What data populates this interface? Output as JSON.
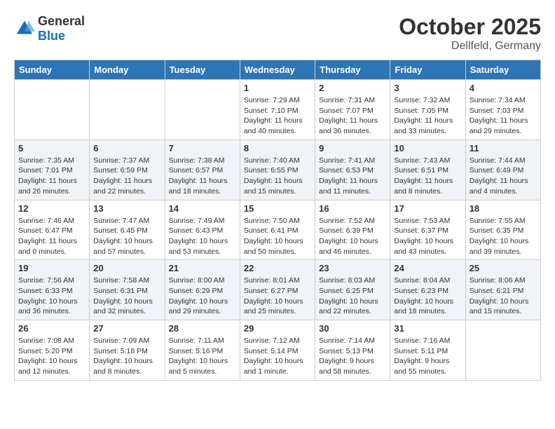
{
  "header": {
    "logo": {
      "general": "General",
      "blue": "Blue"
    },
    "title": "October 2025",
    "location": "Dellfeld, Germany"
  },
  "calendar": {
    "days_of_week": [
      "Sunday",
      "Monday",
      "Tuesday",
      "Wednesday",
      "Thursday",
      "Friday",
      "Saturday"
    ],
    "weeks": [
      [
        {
          "day": "",
          "info": ""
        },
        {
          "day": "",
          "info": ""
        },
        {
          "day": "",
          "info": ""
        },
        {
          "day": "1",
          "info": "Sunrise: 7:29 AM\nSunset: 7:10 PM\nDaylight: 11 hours and 40 minutes."
        },
        {
          "day": "2",
          "info": "Sunrise: 7:31 AM\nSunset: 7:07 PM\nDaylight: 11 hours and 36 minutes."
        },
        {
          "day": "3",
          "info": "Sunrise: 7:32 AM\nSunset: 7:05 PM\nDaylight: 11 hours and 33 minutes."
        },
        {
          "day": "4",
          "info": "Sunrise: 7:34 AM\nSunset: 7:03 PM\nDaylight: 11 hours and 29 minutes."
        }
      ],
      [
        {
          "day": "5",
          "info": "Sunrise: 7:35 AM\nSunset: 7:01 PM\nDaylight: 11 hours and 26 minutes."
        },
        {
          "day": "6",
          "info": "Sunrise: 7:37 AM\nSunset: 6:59 PM\nDaylight: 11 hours and 22 minutes."
        },
        {
          "day": "7",
          "info": "Sunrise: 7:38 AM\nSunset: 6:57 PM\nDaylight: 11 hours and 18 minutes."
        },
        {
          "day": "8",
          "info": "Sunrise: 7:40 AM\nSunset: 6:55 PM\nDaylight: 11 hours and 15 minutes."
        },
        {
          "day": "9",
          "info": "Sunrise: 7:41 AM\nSunset: 6:53 PM\nDaylight: 11 hours and 11 minutes."
        },
        {
          "day": "10",
          "info": "Sunrise: 7:43 AM\nSunset: 6:51 PM\nDaylight: 11 hours and 8 minutes."
        },
        {
          "day": "11",
          "info": "Sunrise: 7:44 AM\nSunset: 6:49 PM\nDaylight: 11 hours and 4 minutes."
        }
      ],
      [
        {
          "day": "12",
          "info": "Sunrise: 7:46 AM\nSunset: 6:47 PM\nDaylight: 11 hours and 0 minutes."
        },
        {
          "day": "13",
          "info": "Sunrise: 7:47 AM\nSunset: 6:45 PM\nDaylight: 10 hours and 57 minutes."
        },
        {
          "day": "14",
          "info": "Sunrise: 7:49 AM\nSunset: 6:43 PM\nDaylight: 10 hours and 53 minutes."
        },
        {
          "day": "15",
          "info": "Sunrise: 7:50 AM\nSunset: 6:41 PM\nDaylight: 10 hours and 50 minutes."
        },
        {
          "day": "16",
          "info": "Sunrise: 7:52 AM\nSunset: 6:39 PM\nDaylight: 10 hours and 46 minutes."
        },
        {
          "day": "17",
          "info": "Sunrise: 7:53 AM\nSunset: 6:37 PM\nDaylight: 10 hours and 43 minutes."
        },
        {
          "day": "18",
          "info": "Sunrise: 7:55 AM\nSunset: 6:35 PM\nDaylight: 10 hours and 39 minutes."
        }
      ],
      [
        {
          "day": "19",
          "info": "Sunrise: 7:56 AM\nSunset: 6:33 PM\nDaylight: 10 hours and 36 minutes."
        },
        {
          "day": "20",
          "info": "Sunrise: 7:58 AM\nSunset: 6:31 PM\nDaylight: 10 hours and 32 minutes."
        },
        {
          "day": "21",
          "info": "Sunrise: 8:00 AM\nSunset: 6:29 PM\nDaylight: 10 hours and 29 minutes."
        },
        {
          "day": "22",
          "info": "Sunrise: 8:01 AM\nSunset: 6:27 PM\nDaylight: 10 hours and 25 minutes."
        },
        {
          "day": "23",
          "info": "Sunrise: 8:03 AM\nSunset: 6:25 PM\nDaylight: 10 hours and 22 minutes."
        },
        {
          "day": "24",
          "info": "Sunrise: 8:04 AM\nSunset: 6:23 PM\nDaylight: 10 hours and 18 minutes."
        },
        {
          "day": "25",
          "info": "Sunrise: 8:06 AM\nSunset: 6:21 PM\nDaylight: 10 hours and 15 minutes."
        }
      ],
      [
        {
          "day": "26",
          "info": "Sunrise: 7:08 AM\nSunset: 5:20 PM\nDaylight: 10 hours and 12 minutes."
        },
        {
          "day": "27",
          "info": "Sunrise: 7:09 AM\nSunset: 5:18 PM\nDaylight: 10 hours and 8 minutes."
        },
        {
          "day": "28",
          "info": "Sunrise: 7:11 AM\nSunset: 5:16 PM\nDaylight: 10 hours and 5 minutes."
        },
        {
          "day": "29",
          "info": "Sunrise: 7:12 AM\nSunset: 5:14 PM\nDaylight: 10 hours and 1 minute."
        },
        {
          "day": "30",
          "info": "Sunrise: 7:14 AM\nSunset: 5:13 PM\nDaylight: 9 hours and 58 minutes."
        },
        {
          "day": "31",
          "info": "Sunrise: 7:16 AM\nSunset: 5:11 PM\nDaylight: 9 hours and 55 minutes."
        },
        {
          "day": "",
          "info": ""
        }
      ]
    ]
  }
}
